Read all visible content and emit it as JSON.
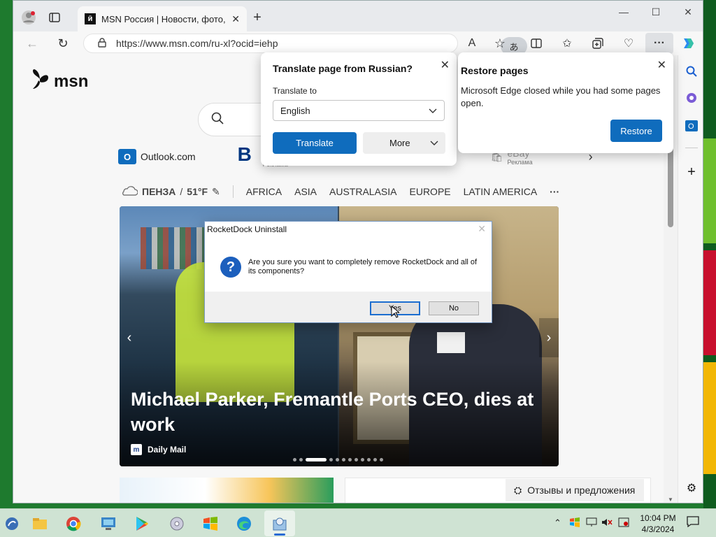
{
  "browser": {
    "tab_title": "MSN Россия | Новости, фото, по",
    "url": "https://www.msn.com/ru-xl?ocid=iehp",
    "translate_pill_glyph": "あ",
    "read_aloud_glyph": "A",
    "colors": {
      "accent": "#0f6cbd",
      "desktop": "#1e7a2e"
    }
  },
  "page": {
    "logo_text": "msn",
    "quick_links": [
      {
        "label": "Outlook.com"
      },
      {
        "label": "B",
        "ad": "Реклама"
      },
      {
        "label": "eBay",
        "ad": "Реклама"
      }
    ],
    "weather": {
      "city": "ПЕНЗА",
      "sep": "/",
      "temp": "51°F"
    },
    "nav": [
      "AFRICA",
      "ASIA",
      "AUSTRALASIA",
      "EUROPE",
      "LATIN AMERICA"
    ],
    "nav_more": "···",
    "hero": {
      "title": "Michael Parker, Fremantle Ports CEO, dies at work",
      "source": "Daily Mail",
      "source_icon": "m",
      "dot_count": 12,
      "active_dot": 2
    },
    "feedback_label": "Отзывы и предложения"
  },
  "translate_popup": {
    "title": "Translate page from Russian?",
    "label": "Translate to",
    "selected_language": "English",
    "translate_btn": "Translate",
    "more_btn": "More"
  },
  "restore_popup": {
    "title": "Restore pages",
    "message": "Microsoft Edge closed while you had some pages open.",
    "button": "Restore"
  },
  "dialog": {
    "title": "RocketDock Uninstall",
    "message": "Are you sure you want to completely remove RocketDock and all of its components?",
    "yes": "Yes",
    "no": "No"
  },
  "taskbar": {
    "time": "10:04 PM",
    "date": "4/3/2024"
  }
}
